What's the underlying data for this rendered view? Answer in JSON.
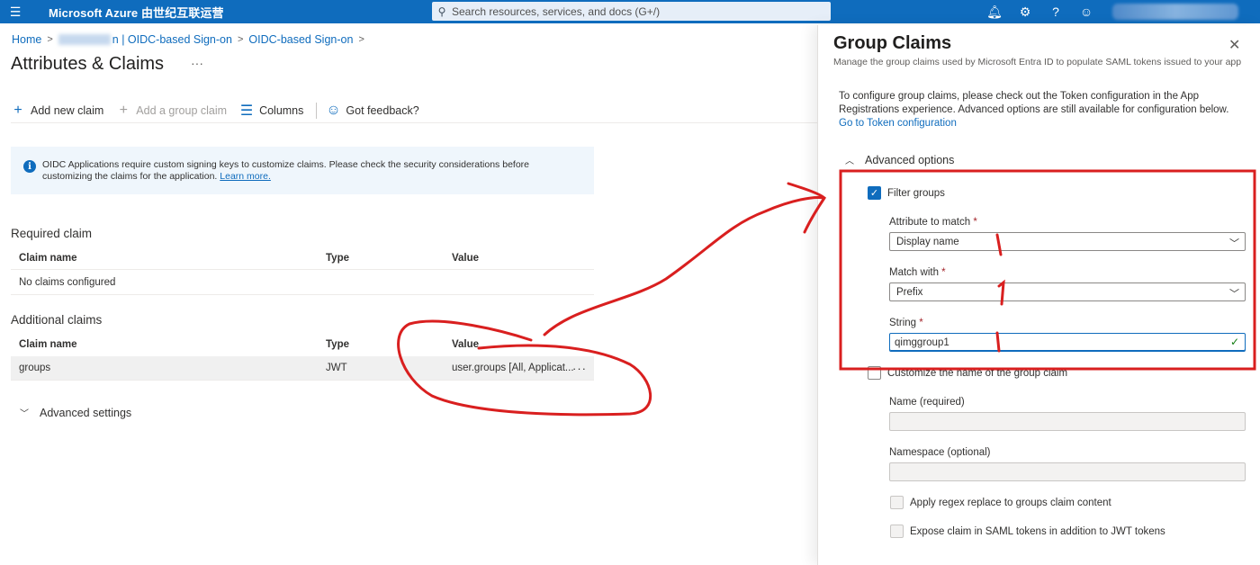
{
  "topbar": {
    "menu_icon": "hamburger-icon",
    "brand": "Microsoft Azure 由世纪互联运营",
    "search_placeholder": "Search resources, services, and docs (G+/)",
    "icons": [
      "bell-icon",
      "gear-icon",
      "help-icon",
      "feedback-icon"
    ]
  },
  "breadcrumb": {
    "home": "Home",
    "app_suffix": "n | OIDC-based Sign-on",
    "current": "OIDC-based Sign-on"
  },
  "page": {
    "title": "Attributes & Claims",
    "more": "···"
  },
  "toolbar": {
    "add_new_claim": "Add new claim",
    "add_group_claim": "Add a group claim",
    "columns": "Columns",
    "feedback": "Got feedback?"
  },
  "infobar": {
    "text": "OIDC Applications require custom signing keys to customize claims. Please check the security considerations before customizing the claims for the application.",
    "link": "Learn more."
  },
  "required": {
    "title": "Required claim",
    "headers": [
      "Claim name",
      "Type",
      "Value"
    ],
    "empty": "No claims configured"
  },
  "additional": {
    "title": "Additional claims",
    "headers": [
      "Claim name",
      "Type",
      "Value"
    ],
    "rows": [
      {
        "name": "groups",
        "type": "JWT",
        "value": "user.groups [All, Applicat...",
        "more": "···"
      }
    ]
  },
  "advanced_settings": "Advanced settings",
  "panel": {
    "title": "Group Claims",
    "close": "✕",
    "subtitle": "Manage the group claims used by Microsoft Entra ID to populate SAML tokens issued to your app",
    "desc": "To configure group claims, please check out the Token configuration in the App Registrations experience. Advanced options are still available for configuration below.",
    "desc_link": "Go to Token configuration",
    "advanced_options": "Advanced options",
    "filter_groups": {
      "label": "Filter groups",
      "checked": true
    },
    "attribute_to_match": {
      "label": "Attribute to match",
      "value": "Display name"
    },
    "match_with": {
      "label": "Match with",
      "value": "Prefix"
    },
    "string": {
      "label": "String",
      "value": "qimggroup1"
    },
    "required_mark": "*",
    "customize_name": {
      "label": "Customize the name of the group claim",
      "checked": false
    },
    "name_field": {
      "label": "Name (required)",
      "value": ""
    },
    "namespace_field": {
      "label": "Namespace (optional)",
      "value": ""
    },
    "regex": {
      "label": "Apply regex replace to groups claim content",
      "checked": false
    },
    "expose_saml": {
      "label": "Expose claim in SAML tokens in addition to JWT tokens",
      "checked": false
    }
  },
  "colors": {
    "accent": "#0f6cbd",
    "annotation": "#d91f1f",
    "topbar": "#0f6cbd"
  }
}
